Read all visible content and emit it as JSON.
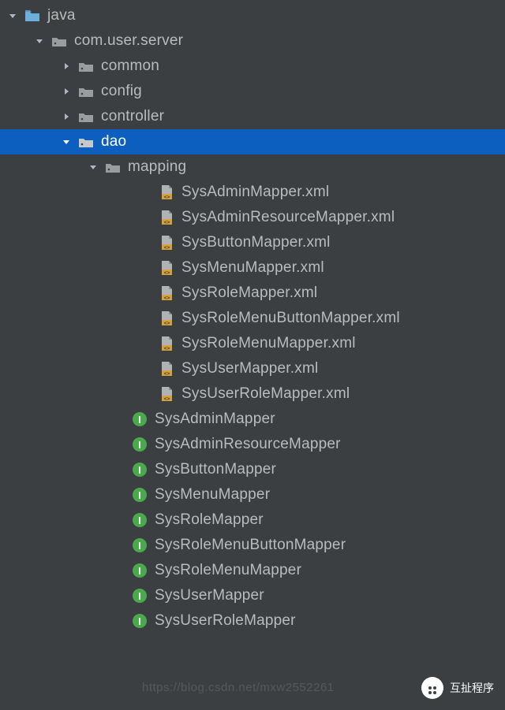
{
  "colors": {
    "bg": "#3c3f41",
    "text": "#bbbbbb",
    "selectedBg": "#0d5fbf",
    "selectedText": "#ffffff",
    "folderBlue": "#6dafdb",
    "folderGrey": "#9a9da0",
    "xmlIcon": "#d6a33a",
    "interfaceIcon": "#4ca84c"
  },
  "tree": [
    {
      "indent": 0,
      "arrow": "down",
      "icon": "folder-blue",
      "label": "java",
      "selected": false
    },
    {
      "indent": 1,
      "arrow": "down",
      "icon": "package",
      "label": "com.user.server",
      "selected": false
    },
    {
      "indent": 2,
      "arrow": "right",
      "icon": "package",
      "label": "common",
      "selected": false
    },
    {
      "indent": 2,
      "arrow": "right",
      "icon": "package",
      "label": "config",
      "selected": false
    },
    {
      "indent": 2,
      "arrow": "right",
      "icon": "package",
      "label": "controller",
      "selected": false
    },
    {
      "indent": 2,
      "arrow": "down",
      "icon": "package",
      "label": "dao",
      "selected": true
    },
    {
      "indent": 3,
      "arrow": "down",
      "icon": "package",
      "label": "mapping",
      "selected": false
    },
    {
      "indent": 5,
      "arrow": "none",
      "icon": "xml",
      "label": "SysAdminMapper.xml",
      "selected": false
    },
    {
      "indent": 5,
      "arrow": "none",
      "icon": "xml",
      "label": "SysAdminResourceMapper.xml",
      "selected": false
    },
    {
      "indent": 5,
      "arrow": "none",
      "icon": "xml",
      "label": "SysButtonMapper.xml",
      "selected": false
    },
    {
      "indent": 5,
      "arrow": "none",
      "icon": "xml",
      "label": "SysMenuMapper.xml",
      "selected": false
    },
    {
      "indent": 5,
      "arrow": "none",
      "icon": "xml",
      "label": "SysRoleMapper.xml",
      "selected": false
    },
    {
      "indent": 5,
      "arrow": "none",
      "icon": "xml",
      "label": "SysRoleMenuButtonMapper.xml",
      "selected": false
    },
    {
      "indent": 5,
      "arrow": "none",
      "icon": "xml",
      "label": "SysRoleMenuMapper.xml",
      "selected": false
    },
    {
      "indent": 5,
      "arrow": "none",
      "icon": "xml",
      "label": "SysUserMapper.xml",
      "selected": false
    },
    {
      "indent": 5,
      "arrow": "none",
      "icon": "xml",
      "label": "SysUserRoleMapper.xml",
      "selected": false
    },
    {
      "indent": 4,
      "arrow": "none",
      "icon": "interface",
      "label": "SysAdminMapper",
      "selected": false
    },
    {
      "indent": 4,
      "arrow": "none",
      "icon": "interface",
      "label": "SysAdminResourceMapper",
      "selected": false
    },
    {
      "indent": 4,
      "arrow": "none",
      "icon": "interface",
      "label": "SysButtonMapper",
      "selected": false
    },
    {
      "indent": 4,
      "arrow": "none",
      "icon": "interface",
      "label": "SysMenuMapper",
      "selected": false
    },
    {
      "indent": 4,
      "arrow": "none",
      "icon": "interface",
      "label": "SysRoleMapper",
      "selected": false
    },
    {
      "indent": 4,
      "arrow": "none",
      "icon": "interface",
      "label": "SysRoleMenuButtonMapper",
      "selected": false
    },
    {
      "indent": 4,
      "arrow": "none",
      "icon": "interface",
      "label": "SysRoleMenuMapper",
      "selected": false
    },
    {
      "indent": 4,
      "arrow": "none",
      "icon": "interface",
      "label": "SysUserMapper",
      "selected": false
    },
    {
      "indent": 4,
      "arrow": "none",
      "icon": "interface",
      "label": "SysUserRoleMapper",
      "selected": false
    }
  ],
  "watermark": {
    "label": "互扯程序"
  },
  "csdn": "https://blog.csdn.net/mxw2552261"
}
